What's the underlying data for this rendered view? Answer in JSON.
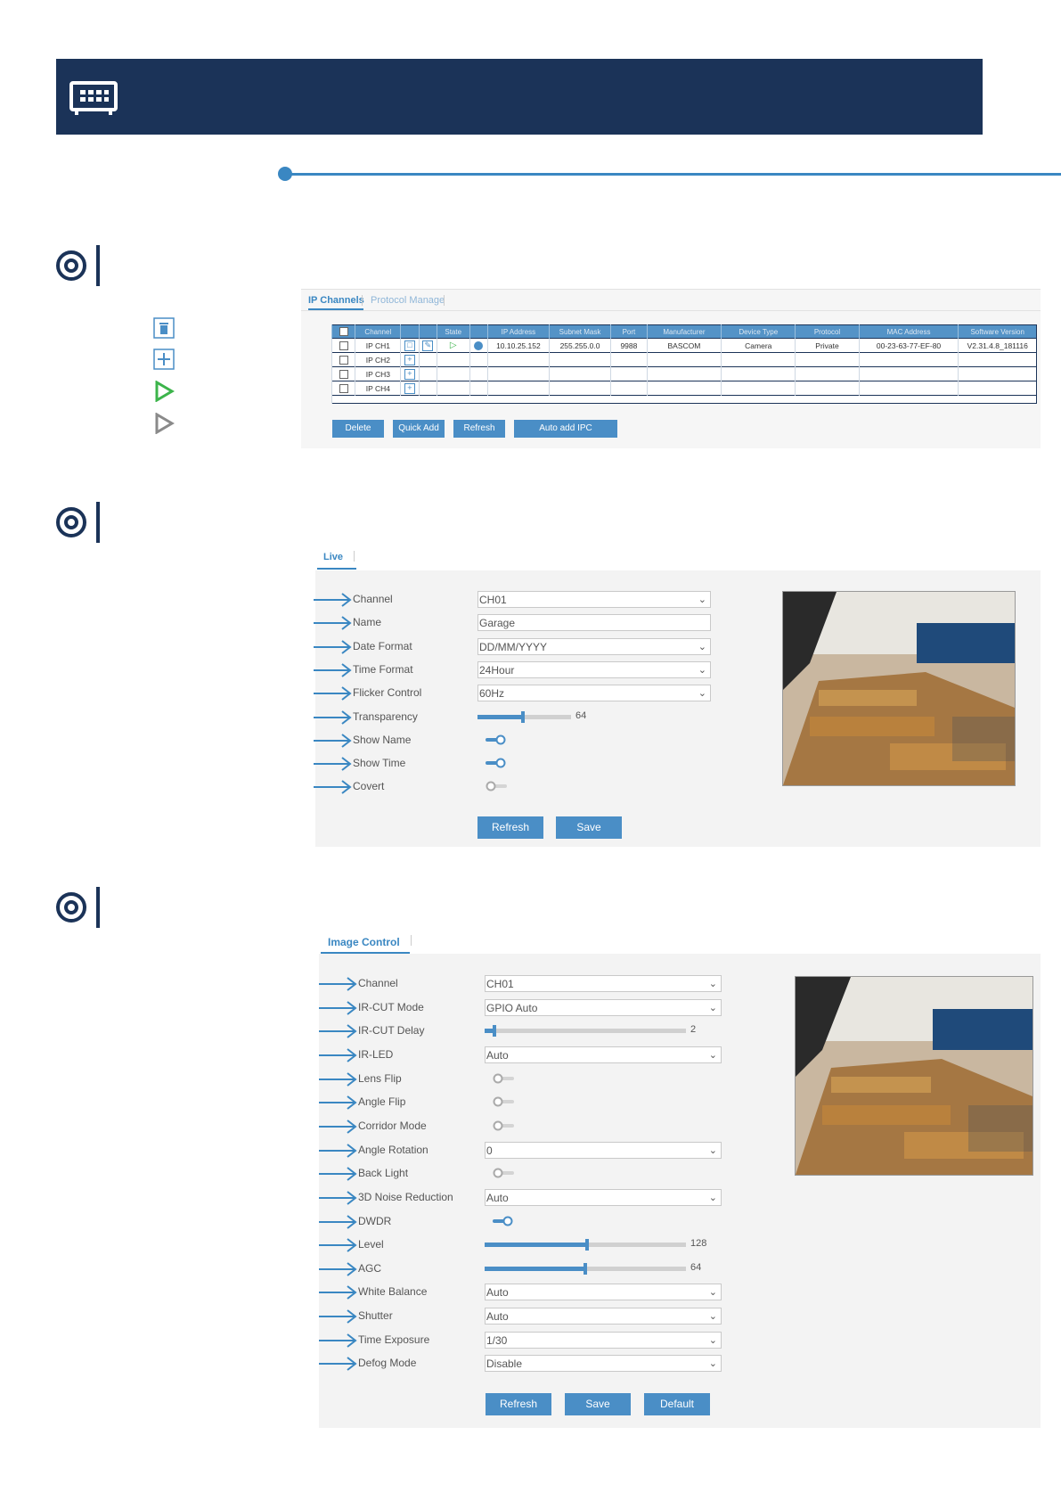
{
  "header": {
    "icon": "keyboard-icon"
  },
  "legend": {
    "icons": [
      "delete-icon",
      "add-icon",
      "play-enabled-icon",
      "play-disabled-icon"
    ]
  },
  "ip_panel": {
    "tabs": [
      "IP Channels",
      "Protocol Manage"
    ],
    "columns": [
      "Channel",
      "State",
      "IP Address",
      "Subnet Mask",
      "Port",
      "Manufacturer",
      "Device Type",
      "Protocol",
      "MAC Address",
      "Software Version"
    ],
    "rows": [
      {
        "channel": "IP CH1",
        "ip": "10.10.25.152",
        "mask": "255.255.0.0",
        "port": "9988",
        "manufacturer": "BASCOM",
        "type": "Camera",
        "protocol": "Private",
        "mac": "00-23-63-77-EF-80",
        "version": "V2.31.4.8_181116"
      },
      {
        "channel": "IP CH2"
      },
      {
        "channel": "IP CH3"
      },
      {
        "channel": "IP CH4"
      }
    ],
    "buttons": {
      "delete": "Delete",
      "quick_add": "Quick Add",
      "refresh": "Refresh",
      "auto_add": "Auto add IPC"
    }
  },
  "live_panel": {
    "tab": "Live",
    "labels": {
      "channel": "Channel",
      "name": "Name",
      "date_format": "Date Format",
      "time_format": "Time Format",
      "flicker": "Flicker Control",
      "transparency": "Transparency",
      "show_name": "Show Name",
      "show_time": "Show Time",
      "covert": "Covert"
    },
    "values": {
      "channel": "CH01",
      "name": "Garage",
      "date_format": "DD/MM/YYYY",
      "time_format": "24Hour",
      "flicker": "60Hz",
      "transparency": "64"
    },
    "transparency_fraction": 0.47,
    "toggles": {
      "show_name": true,
      "show_time": true,
      "covert": false
    },
    "buttons": {
      "refresh": "Refresh",
      "save": "Save"
    }
  },
  "image_panel": {
    "tab": "Image Control",
    "labels": {
      "channel": "Channel",
      "ircut_mode": "IR-CUT Mode",
      "ircut_delay": "IR-CUT Delay",
      "ir_led": "IR-LED",
      "lens_flip": "Lens Flip",
      "angle_flip": "Angle Flip",
      "corridor": "Corridor Mode",
      "angle_rotation": "Angle Rotation",
      "back_light": "Back Light",
      "noise": "3D Noise Reduction",
      "dwdr": "DWDR",
      "level": "Level",
      "agc": "AGC",
      "white_balance": "White Balance",
      "shutter": "Shutter",
      "time_exposure": "Time Exposure",
      "defog": "Defog Mode"
    },
    "values": {
      "channel": "CH01",
      "ircut_mode": "GPIO Auto",
      "ircut_delay": "2",
      "ir_led": "Auto",
      "angle_rotation": "0",
      "noise": "Auto",
      "level": "128",
      "agc": "64",
      "white_balance": "Auto",
      "shutter": "Auto",
      "time_exposure": "1/30",
      "defog": "Disable"
    },
    "sliders": {
      "ircut_delay": 0.04,
      "level": 0.5,
      "agc": 0.49
    },
    "toggles": {
      "lens_flip": false,
      "angle_flip": false,
      "corridor": false,
      "back_light": false,
      "dwdr": true
    },
    "buttons": {
      "refresh": "Refresh",
      "save": "Save",
      "default": "Default"
    }
  },
  "colors": {
    "banner": "#1b3358",
    "accent": "#3a87c2",
    "button": "#4a8ec6"
  }
}
